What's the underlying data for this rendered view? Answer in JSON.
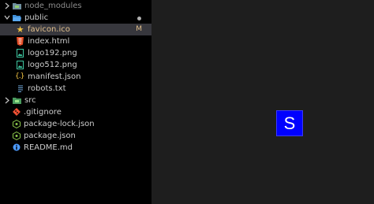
{
  "explorer": {
    "items": [
      {
        "label": "node_modules",
        "icon": "folder-icon"
      },
      {
        "label": "public",
        "icon": "folder-open-icon"
      },
      {
        "label": "favicon.ico",
        "icon": "star-icon",
        "badge": "M"
      },
      {
        "label": "index.html",
        "icon": "html5-icon"
      },
      {
        "label": "logo192.png",
        "icon": "image-icon"
      },
      {
        "label": "logo512.png",
        "icon": "image-icon"
      },
      {
        "label": "manifest.json",
        "icon": "json-braces-icon"
      },
      {
        "label": "robots.txt",
        "icon": "text-file-icon"
      },
      {
        "label": "src",
        "icon": "folder-icon"
      },
      {
        "label": ".gitignore",
        "icon": "git-icon"
      },
      {
        "label": "package-lock.json",
        "icon": "nodejs-icon"
      },
      {
        "label": "package.json",
        "icon": "nodejs-icon"
      },
      {
        "label": "README.md",
        "icon": "info-icon"
      }
    ]
  },
  "preview": {
    "logo_letter": "S"
  },
  "colors": {
    "sidebar_bg": "#000000",
    "editor_bg": "#1e1e1e",
    "selection_bg": "#37373d",
    "modified": "#e2c08d",
    "logo_bg": "#0000ff"
  }
}
